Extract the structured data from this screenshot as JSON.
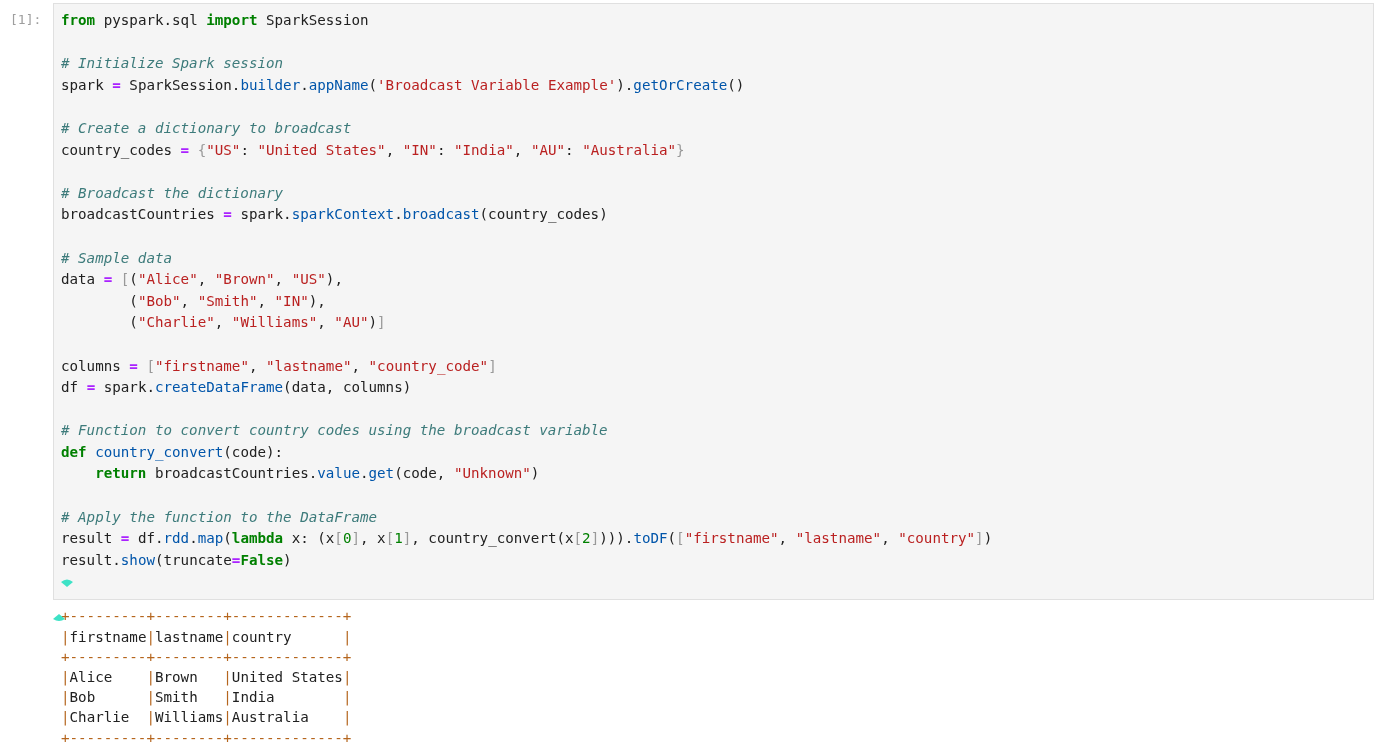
{
  "cell": {
    "prompt": "[1]:",
    "code_lines": [
      {
        "kind": "code",
        "tokens": [
          {
            "kind": "k",
            "text": "from"
          },
          {
            "kind": "n",
            "text": " pyspark.sql "
          },
          {
            "kind": "k",
            "text": "import"
          },
          {
            "kind": "n",
            "text": " SparkSession"
          }
        ]
      },
      {
        "kind": "blank"
      },
      {
        "kind": "code",
        "tokens": [
          {
            "kind": "c",
            "text": "# Initialize Spark session"
          }
        ]
      },
      {
        "kind": "code",
        "tokens": [
          {
            "kind": "n",
            "text": "spark "
          },
          {
            "kind": "o",
            "text": "="
          },
          {
            "kind": "n",
            "text": " SparkSession."
          },
          {
            "kind": "f",
            "text": "builder"
          },
          {
            "kind": "n",
            "text": "."
          },
          {
            "kind": "f",
            "text": "appName"
          },
          {
            "kind": "n",
            "text": "("
          },
          {
            "kind": "s",
            "text": "'Broadcast Variable Example'"
          },
          {
            "kind": "n",
            "text": ")."
          },
          {
            "kind": "f",
            "text": "getOrCreate"
          },
          {
            "kind": "n",
            "text": "()"
          }
        ]
      },
      {
        "kind": "blank"
      },
      {
        "kind": "code",
        "tokens": [
          {
            "kind": "c",
            "text": "# Create a dictionary to broadcast"
          }
        ]
      },
      {
        "kind": "code",
        "tokens": [
          {
            "kind": "n",
            "text": "country_codes "
          },
          {
            "kind": "o",
            "text": "= "
          },
          {
            "kind": "p",
            "text": "{"
          },
          {
            "kind": "s",
            "text": "\"US\""
          },
          {
            "kind": "n",
            "text": ": "
          },
          {
            "kind": "s",
            "text": "\"United States\""
          },
          {
            "kind": "n",
            "text": ", "
          },
          {
            "kind": "s",
            "text": "\"IN\""
          },
          {
            "kind": "n",
            "text": ": "
          },
          {
            "kind": "s",
            "text": "\"India\""
          },
          {
            "kind": "n",
            "text": ", "
          },
          {
            "kind": "s",
            "text": "\"AU\""
          },
          {
            "kind": "n",
            "text": ": "
          },
          {
            "kind": "s",
            "text": "\"Australia\""
          },
          {
            "kind": "p",
            "text": "}"
          }
        ]
      },
      {
        "kind": "blank"
      },
      {
        "kind": "code",
        "tokens": [
          {
            "kind": "c",
            "text": "# Broadcast the dictionary"
          }
        ]
      },
      {
        "kind": "code",
        "tokens": [
          {
            "kind": "n",
            "text": "broadcastCountries "
          },
          {
            "kind": "o",
            "text": "="
          },
          {
            "kind": "n",
            "text": " spark."
          },
          {
            "kind": "f",
            "text": "sparkContext"
          },
          {
            "kind": "n",
            "text": "."
          },
          {
            "kind": "f",
            "text": "broadcast"
          },
          {
            "kind": "n",
            "text": "(country_codes)"
          }
        ]
      },
      {
        "kind": "blank"
      },
      {
        "kind": "code",
        "tokens": [
          {
            "kind": "c",
            "text": "# Sample data"
          }
        ]
      },
      {
        "kind": "code",
        "tokens": [
          {
            "kind": "n",
            "text": "data "
          },
          {
            "kind": "o",
            "text": "= "
          },
          {
            "kind": "p",
            "text": "["
          },
          {
            "kind": "n",
            "text": "("
          },
          {
            "kind": "s",
            "text": "\"Alice\""
          },
          {
            "kind": "n",
            "text": ", "
          },
          {
            "kind": "s",
            "text": "\"Brown\""
          },
          {
            "kind": "n",
            "text": ", "
          },
          {
            "kind": "s",
            "text": "\"US\""
          },
          {
            "kind": "n",
            "text": "),"
          }
        ]
      },
      {
        "kind": "code",
        "tokens": [
          {
            "kind": "n",
            "text": "        ("
          },
          {
            "kind": "s",
            "text": "\"Bob\""
          },
          {
            "kind": "n",
            "text": ", "
          },
          {
            "kind": "s",
            "text": "\"Smith\""
          },
          {
            "kind": "n",
            "text": ", "
          },
          {
            "kind": "s",
            "text": "\"IN\""
          },
          {
            "kind": "n",
            "text": "),"
          }
        ]
      },
      {
        "kind": "code",
        "tokens": [
          {
            "kind": "n",
            "text": "        ("
          },
          {
            "kind": "s",
            "text": "\"Charlie\""
          },
          {
            "kind": "n",
            "text": ", "
          },
          {
            "kind": "s",
            "text": "\"Williams\""
          },
          {
            "kind": "n",
            "text": ", "
          },
          {
            "kind": "s",
            "text": "\"AU\""
          },
          {
            "kind": "n",
            "text": ")"
          },
          {
            "kind": "p",
            "text": "]"
          }
        ]
      },
      {
        "kind": "blank"
      },
      {
        "kind": "code",
        "tokens": [
          {
            "kind": "n",
            "text": "columns "
          },
          {
            "kind": "o",
            "text": "= "
          },
          {
            "kind": "p",
            "text": "["
          },
          {
            "kind": "s",
            "text": "\"firstname\""
          },
          {
            "kind": "n",
            "text": ", "
          },
          {
            "kind": "s",
            "text": "\"lastname\""
          },
          {
            "kind": "n",
            "text": ", "
          },
          {
            "kind": "s",
            "text": "\"country_code\""
          },
          {
            "kind": "p",
            "text": "]"
          }
        ]
      },
      {
        "kind": "code",
        "tokens": [
          {
            "kind": "n",
            "text": "df "
          },
          {
            "kind": "o",
            "text": "="
          },
          {
            "kind": "n",
            "text": " spark."
          },
          {
            "kind": "f",
            "text": "createDataFrame"
          },
          {
            "kind": "n",
            "text": "(data, columns)"
          }
        ]
      },
      {
        "kind": "blank"
      },
      {
        "kind": "code",
        "tokens": [
          {
            "kind": "c",
            "text": "# Function to convert country codes using the broadcast variable"
          }
        ]
      },
      {
        "kind": "code",
        "tokens": [
          {
            "kind": "k",
            "text": "def "
          },
          {
            "kind": "f",
            "text": "country_convert"
          },
          {
            "kind": "n",
            "text": "(code):"
          }
        ]
      },
      {
        "kind": "code",
        "tokens": [
          {
            "kind": "k",
            "text": "    return"
          },
          {
            "kind": "n",
            "text": " broadcastCountries."
          },
          {
            "kind": "f",
            "text": "value"
          },
          {
            "kind": "n",
            "text": "."
          },
          {
            "kind": "f",
            "text": "get"
          },
          {
            "kind": "n",
            "text": "(code, "
          },
          {
            "kind": "s",
            "text": "\"Unknown\""
          },
          {
            "kind": "n",
            "text": ")"
          }
        ]
      },
      {
        "kind": "blank"
      },
      {
        "kind": "code",
        "tokens": [
          {
            "kind": "c",
            "text": "# Apply the function to the DataFrame"
          }
        ]
      },
      {
        "kind": "code",
        "tokens": [
          {
            "kind": "n",
            "text": "result "
          },
          {
            "kind": "o",
            "text": "="
          },
          {
            "kind": "n",
            "text": " df."
          },
          {
            "kind": "f",
            "text": "rdd"
          },
          {
            "kind": "n",
            "text": "."
          },
          {
            "kind": "f",
            "text": "map"
          },
          {
            "kind": "n",
            "text": "("
          },
          {
            "kind": "k",
            "text": "lambda"
          },
          {
            "kind": "n",
            "text": " x: (x"
          },
          {
            "kind": "p",
            "text": "["
          },
          {
            "kind": "m",
            "text": "0"
          },
          {
            "kind": "p",
            "text": "]"
          },
          {
            "kind": "n",
            "text": ", x"
          },
          {
            "kind": "p",
            "text": "["
          },
          {
            "kind": "m",
            "text": "1"
          },
          {
            "kind": "p",
            "text": "]"
          },
          {
            "kind": "n",
            "text": ", country_convert(x"
          },
          {
            "kind": "p",
            "text": "["
          },
          {
            "kind": "m",
            "text": "2"
          },
          {
            "kind": "p",
            "text": "]"
          },
          {
            "kind": "n",
            "text": ")))."
          },
          {
            "kind": "f",
            "text": "toDF"
          },
          {
            "kind": "n",
            "text": "("
          },
          {
            "kind": "p",
            "text": "["
          },
          {
            "kind": "s",
            "text": "\"firstname\""
          },
          {
            "kind": "n",
            "text": ", "
          },
          {
            "kind": "s",
            "text": "\"lastname\""
          },
          {
            "kind": "n",
            "text": ", "
          },
          {
            "kind": "s",
            "text": "\"country\""
          },
          {
            "kind": "p",
            "text": "]"
          },
          {
            "kind": "n",
            "text": ")"
          }
        ]
      },
      {
        "kind": "code",
        "tokens": [
          {
            "kind": "n",
            "text": "result."
          },
          {
            "kind": "f",
            "text": "show"
          },
          {
            "kind": "n",
            "text": "(truncate"
          },
          {
            "kind": "o",
            "text": "="
          },
          {
            "kind": "k",
            "text": "False"
          },
          {
            "kind": "n",
            "text": ")"
          }
        ]
      }
    ]
  },
  "output_lines": [
    "+---------+--------+-------------+",
    "|firstname|lastname|country      |",
    "+---------+--------+-------------+",
    "|Alice    |Brown   |United States|",
    "|Bob      |Smith   |India        |",
    "|Charlie  |Williams|Australia    |",
    "+---------+--------+-------------+"
  ]
}
